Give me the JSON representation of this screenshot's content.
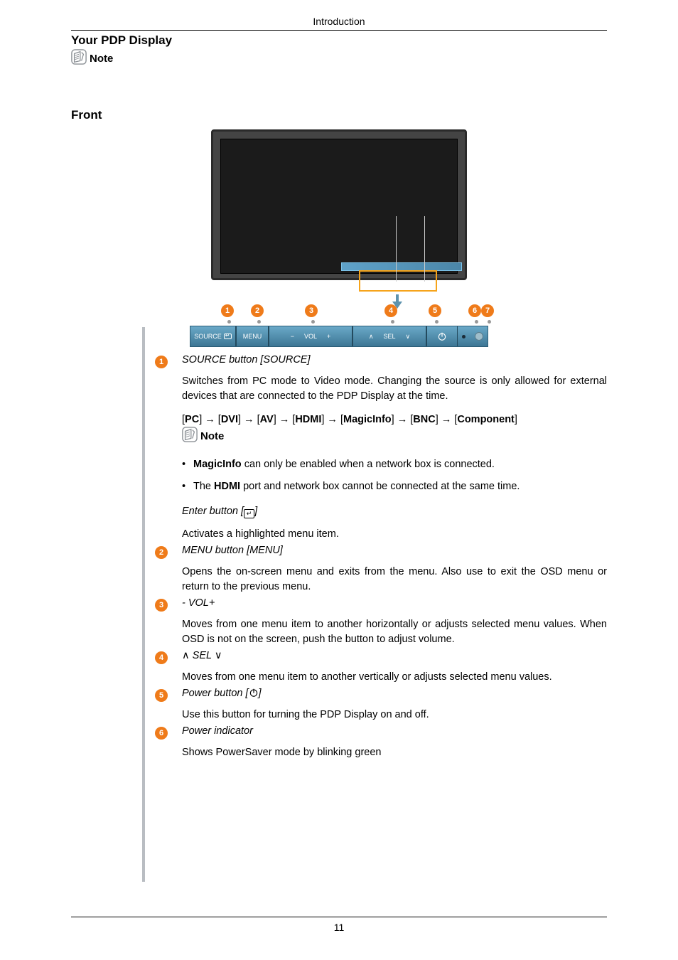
{
  "header": {
    "running_head": "Introduction"
  },
  "title": "Your PDP Display",
  "note_label": "Note",
  "subtitle": "Front",
  "figure": {
    "buttons": {
      "source": "SOURCE",
      "menu": "MENU",
      "vol_minus": "−",
      "vol_label": "VOL",
      "vol_plus": "+",
      "sel_up": "∧",
      "sel_label": "SEL",
      "sel_down": "∨",
      "power": "⏻"
    },
    "callouts": [
      "1",
      "2",
      "3",
      "4",
      "5",
      "6",
      "7"
    ]
  },
  "items": [
    {
      "num": "1",
      "title_plain": "SOURCE button [SOURCE]",
      "body": "Switches from PC mode to Video mode. Changing the source is only allowed for external devices that are connected to the PDP Display at the time.",
      "chain": [
        "PC",
        "DVI",
        "AV",
        "HDMI",
        "MagicInfo",
        "BNC",
        "Component"
      ],
      "note_label": "Note",
      "bullets_b1_strong": "MagicInfo",
      "bullets_b1_rest": " can only be enabled when a network box is connected.",
      "bullets_b2_pre": "The ",
      "bullets_b2_strong": "HDMI",
      "bullets_b2_rest": " port and network box cannot be connected at the same time.",
      "enter_title_pre": "Enter button [",
      "enter_title_post": "]",
      "enter_body": "Activates a highlighted menu item."
    },
    {
      "num": "2",
      "title_plain": "MENU button [MENU]",
      "body": "Opens the on-screen menu and exits from the menu. Also use to exit the OSD menu or return to the previous menu."
    },
    {
      "num": "3",
      "title_plain": "- VOL+",
      "body": "Moves from one menu item to another horizontally or adjusts selected menu values. When OSD is not on the screen, push the button to adjust volume."
    },
    {
      "num": "4",
      "title_pre": "",
      "title_mid": " SEL ",
      "title_post": "",
      "body": "Moves from one menu item to another vertically or adjusts selected menu values."
    },
    {
      "num": "5",
      "title_pre": " Power button [",
      "title_post": "]",
      "body": "Use this button for turning the PDP Display on and off."
    },
    {
      "num": "6",
      "title_plain": "Power indicator",
      "body": "Shows PowerSaver mode by blinking green"
    }
  ],
  "footer": {
    "page": "11"
  }
}
